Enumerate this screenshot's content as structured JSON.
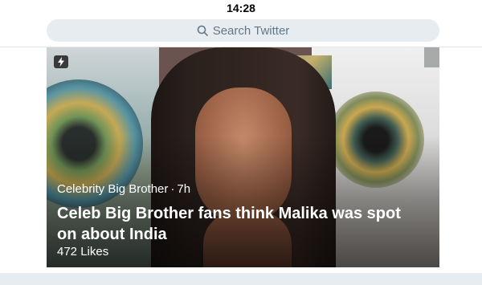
{
  "status": {
    "time": "14:28"
  },
  "search": {
    "placeholder": "Search Twitter"
  },
  "card": {
    "source": "Celebrity Big Brother",
    "separator": "·",
    "age": "7h",
    "headline": "Celeb Big Brother fans think Malika was spot on about India",
    "likes": "472 Likes"
  },
  "icons": [
    "search-icon",
    "lightning-icon"
  ],
  "colors": {
    "search_bg": "#e6ecf0",
    "placeholder": "#657786"
  }
}
